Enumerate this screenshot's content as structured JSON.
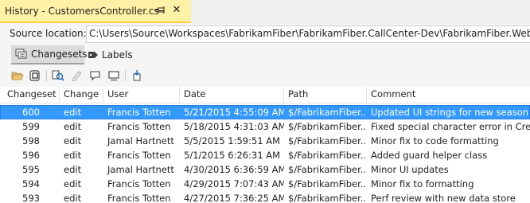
{
  "window": {
    "title": "History - CustomersController.cs",
    "close_glyph": "✕"
  },
  "source_location": {
    "label": "Source location:",
    "value": "C:\\Users\\Source\\Workspaces\\FabrikamFiber\\FabrikamFiber.CallCenter-Dev\\FabrikamFiber.Web\\Controllers\\CustomersController.cs"
  },
  "tabs": [
    {
      "label": "Changesets",
      "icon": "changesets-icon",
      "active": true
    },
    {
      "label": "Labels",
      "icon": "label-tag-icon",
      "active": false
    }
  ],
  "toolbar": {
    "buttons": [
      "open-folder-icon",
      "get-version-icon",
      "compare-icon",
      "annotate-icon",
      "comment-icon",
      "changeset-details-icon",
      "track-changeset-icon"
    ]
  },
  "colors": {
    "title_tab_bg": "#fff1a6",
    "title_tab_border": "#ffcf40",
    "selection": "#3399ff"
  },
  "table": {
    "columns": [
      "Changeset",
      "Change",
      "User",
      "Date",
      "Path",
      "Comment"
    ],
    "rows": [
      {
        "changeset": "600",
        "change": "edit",
        "user": "Francis Totten",
        "date": "5/21/2015 4:55:09 AM",
        "path": "$/FabrikamFiber...",
        "comment": "Updated UI strings for new season",
        "selected": true
      },
      {
        "changeset": "599",
        "change": "edit",
        "user": "Francis Totten",
        "date": "5/18/2015 4:31:03 AM",
        "path": "$/FabrikamFiber...",
        "comment": "Fixed special character error in Create"
      },
      {
        "changeset": "598",
        "change": "edit",
        "user": "Jamal Hartnett",
        "date": "5/5/2015 1:59:51 AM",
        "path": "$/FabrikamFiber...",
        "comment": "Minor fix to code formatting"
      },
      {
        "changeset": "596",
        "change": "edit",
        "user": "Francis Totten",
        "date": "5/1/2015 6:26:31 AM",
        "path": "$/FabrikamFiber...",
        "comment": "Added guard helper class"
      },
      {
        "changeset": "595",
        "change": "edit",
        "user": "Jamal Hartnett",
        "date": "4/30/2015 6:36:59 AM",
        "path": "$/FabrikamFiber...",
        "comment": "Minor UI updates"
      },
      {
        "changeset": "594",
        "change": "edit",
        "user": "Francis Totten",
        "date": "4/29/2015 7:07:43 AM",
        "path": "$/FabrikamFiber...",
        "comment": "Minor fix to formatting"
      },
      {
        "changeset": "593",
        "change": "edit",
        "user": "Francis Totten",
        "date": "4/27/2015 7:36:25 AM",
        "path": "$/FabrikamFiber...",
        "comment": "Perf review with new data store"
      }
    ]
  }
}
